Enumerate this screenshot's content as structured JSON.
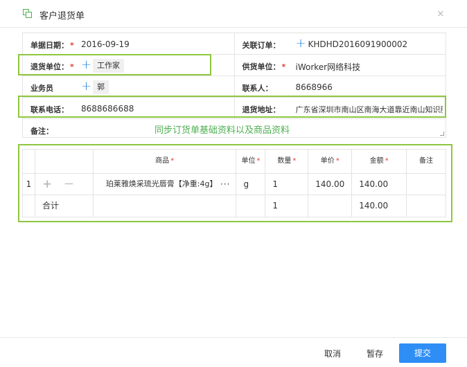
{
  "dialog": {
    "title": "客户退货单",
    "icon": "document-copy-icon",
    "close_icon": "close-icon",
    "close_glyph": "×"
  },
  "form": {
    "date_label": "单据日期：",
    "date_value": "2016-09-19",
    "order_label": "关联订单：",
    "order_value": "KHDHD2016091900002",
    "return_unit_label": "退货单位：",
    "return_unit_value": "工作家",
    "supplier_label": "供货单位：",
    "supplier_value": "iWorker网络科技",
    "salesman_label": "业务员",
    "salesman_value": "郭",
    "contact_label": "联系人：",
    "contact_value": "8668966",
    "phone_label": "联系电话：",
    "phone_value": "8688686688",
    "address_label": "退货地址：",
    "address_value": "广东省深圳市南山区南海大道靠近南山知识服务",
    "remark_label": "备注：",
    "required_mark": "*",
    "plus_glyph": "+"
  },
  "annotation": "同步订货单基础资料以及商品资料",
  "table": {
    "headers": {
      "product": "商品",
      "unit": "单位",
      "qty": "数量",
      "price": "单价",
      "amount": "金额",
      "remark": "备注"
    },
    "rows": [
      {
        "index": "1",
        "product": "珀莱雅焕采琉光唇膏【净重:4g】",
        "unit": "g",
        "qty": "1",
        "price": "140.00",
        "amount": "140.00",
        "remark": ""
      }
    ],
    "total": {
      "label": "合计",
      "qty": "1",
      "amount": "140.00"
    },
    "add_glyph": "+",
    "remove_glyph": "—",
    "more_glyph": "···"
  },
  "footer": {
    "cancel": "取消",
    "save": "暂存",
    "submit": "提交"
  },
  "colors": {
    "accent": "#2f8ef5",
    "highlight_box": "#8dc63f",
    "annotation_text": "#4caf50",
    "required": "#e53935"
  }
}
